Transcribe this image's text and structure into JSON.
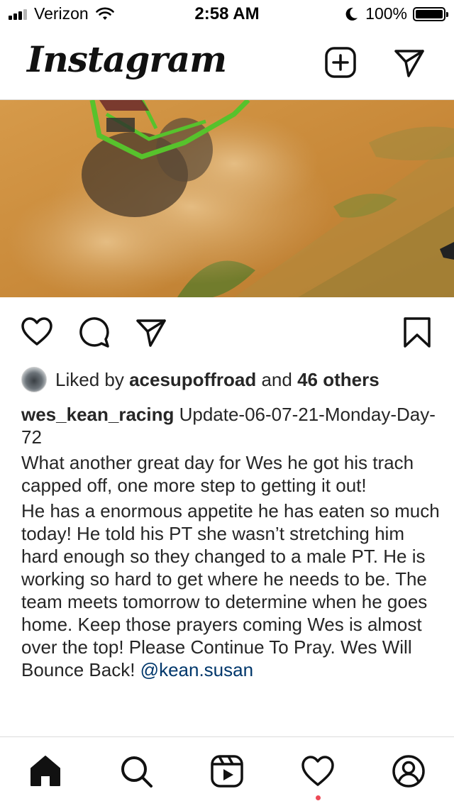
{
  "status_bar": {
    "carrier": "Verizon",
    "time": "2:58 AM",
    "battery": "100%",
    "battery_level": 1.0,
    "signal_bars_active": 3,
    "icons": [
      "signal-icon",
      "wifi-icon",
      "moon-icon",
      "battery-icon"
    ]
  },
  "header": {
    "logo": "Instagram",
    "icons": [
      "new-post-icon",
      "direct-message-icon"
    ]
  },
  "post": {
    "image_icon": "offroad-photo",
    "actions": [
      "like-icon",
      "comment-icon",
      "share-icon",
      "save-icon"
    ],
    "likes": {
      "prefix": "Liked by",
      "user": "acesupoffroad",
      "connector": "and",
      "others": "46 others"
    },
    "caption": {
      "username": "wes_kean_racing",
      "first_line": "Update-06-07-21-Monday-Day-72",
      "paragraph1": "What another great day for Wes he got his trach capped off, one more step to getting it out!",
      "paragraph2": "He has a enormous appetite he has eaten so much today! He told his PT she wasn’t stretching him hard enough so they changed to a male PT. He is working so hard to get where he needs to be. The team meets tomorrow to determine when he goes home. Keep those prayers coming Wes is almost over the top! Please Continue To Pray. Wes Will Bounce Back!",
      "mention": "@kean.susan"
    }
  },
  "tab_bar": {
    "items": [
      "home-icon",
      "search-icon",
      "reels-icon",
      "activity-icon",
      "profile-icon"
    ],
    "notification_color": "#ed4956"
  },
  "colors": {
    "text": "#262626",
    "mention": "#00376b",
    "divider": "#dbdbdb"
  }
}
